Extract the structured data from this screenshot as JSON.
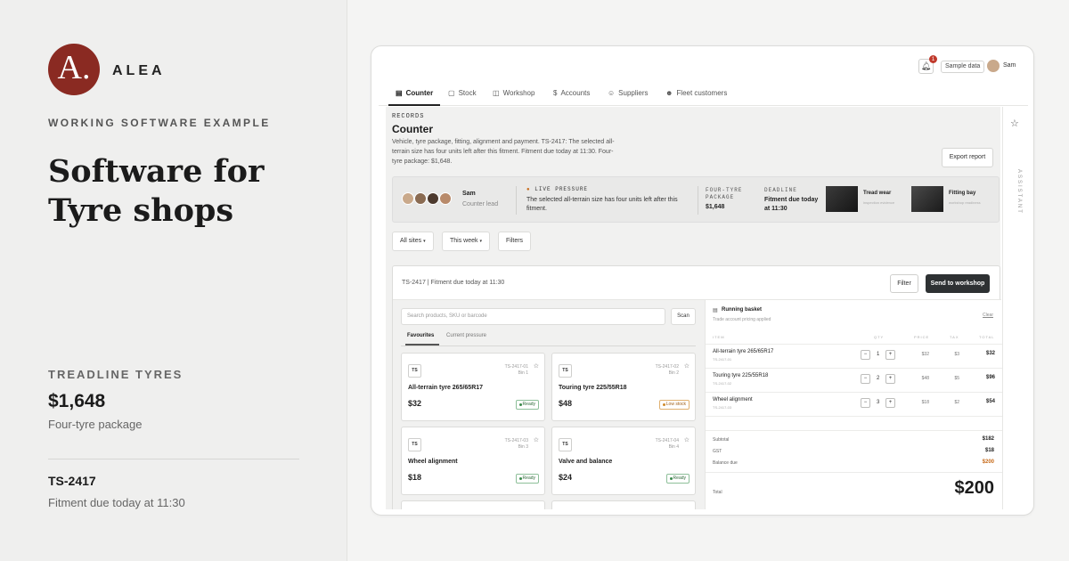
{
  "brand": {
    "logo_letter": "A.",
    "name": "ALEA",
    "eyebrow": "WORKING SOFTWARE EXAMPLE",
    "headline": "Software for Tyre shops",
    "accent": "#8a2a22"
  },
  "summary": {
    "company": "TREADLINE TYRES",
    "amount": "$1,648",
    "amount_label": "Four-tyre package",
    "job_id": "TS-2417",
    "job_status": "Fitment due today at 11:30"
  },
  "topbar": {
    "notification_count": "1",
    "sample_label": "Sample data",
    "user_name": "Sam"
  },
  "tabs": [
    {
      "label": "Counter",
      "icon": "store-icon"
    },
    {
      "label": "Stock",
      "icon": "box-icon"
    },
    {
      "label": "Workshop",
      "icon": "car-icon"
    },
    {
      "label": "Accounts",
      "icon": "dollar-icon"
    },
    {
      "label": "Suppliers",
      "icon": "users-icon"
    },
    {
      "label": "Fleet customers",
      "icon": "fleet-icon"
    }
  ],
  "page": {
    "section": "RECORDS",
    "title": "Counter",
    "description": "Vehicle, tyre package, fitting, alignment and payment. TS-2417: The selected all-terrain size has four units left after this fitment. Fitment due today at 11:30. Four-tyre package: $1,648.",
    "export_label": "Export report"
  },
  "pressure": {
    "person": "Sam",
    "role": "Counter lead",
    "live_label": "LIVE PRESSURE",
    "live_text": "The selected all-terrain size has four units left after this fitment.",
    "package_label": "FOUR-TYRE PACKAGE",
    "package_value": "$1,648",
    "deadline_label": "DEADLINE",
    "deadline_value": "Fitment due today at 11:30",
    "card1_title": "Tread wear",
    "card1_sub": "inspection evidence",
    "card2_title": "Fitting bay",
    "card2_sub": "workshop readiness"
  },
  "filters": {
    "sites": "All sites",
    "period": "This week",
    "filters": "Filters"
  },
  "panel": {
    "header": "TS-2417 | Fitment due today at 11:30",
    "filter_label": "Filter",
    "send_label": "Send to workshop"
  },
  "products": {
    "search_placeholder": "Search products, SKU or barcode",
    "scan_label": "Scan",
    "tab_favourites": "Favourites",
    "tab_pressure": "Current pressure",
    "items": [
      {
        "badge": "TS",
        "code": "TS-2417-01",
        "bin": "Bin 1",
        "name": "All-terrain tyre 265/65R17",
        "price": "$32",
        "status": "Ready"
      },
      {
        "badge": "TS",
        "code": "TS-2417-02",
        "bin": "Bin 2",
        "name": "Touring tyre 225/55R18",
        "price": "$48",
        "status": "Low stock"
      },
      {
        "badge": "TS",
        "code": "TS-2417-03",
        "bin": "Bin 3",
        "name": "Wheel alignment",
        "price": "$18",
        "status": "Ready"
      },
      {
        "badge": "TS",
        "code": "TS-2417-04",
        "bin": "Bin 4",
        "name": "Valve and balance",
        "price": "$24",
        "status": "Ready"
      }
    ]
  },
  "basket": {
    "title": "Running basket",
    "subtitle": "Trade account pricing applied",
    "clear": "Clear",
    "headers": {
      "item": "ITEM",
      "qty": "QTY",
      "price": "PRICE",
      "tax": "TAX",
      "total": "TOTAL"
    },
    "lines": [
      {
        "name": "All-terrain tyre 265/65R17",
        "code": "TS-2417-01",
        "qty": "1",
        "price": "$32",
        "tax": "$3",
        "total": "$32"
      },
      {
        "name": "Touring tyre 225/55R18",
        "code": "TS-2417-02",
        "qty": "2",
        "price": "$48",
        "tax": "$5",
        "total": "$96"
      },
      {
        "name": "Wheel alignment",
        "code": "TS-2417-03",
        "qty": "3",
        "price": "$18",
        "tax": "$2",
        "total": "$54"
      }
    ],
    "subtotal_label": "Subtotal",
    "subtotal": "$182",
    "gst_label": "GST",
    "gst": "$18",
    "due_label": "Balance due",
    "due": "$200",
    "total_label": "Total",
    "total": "$200"
  },
  "assistant_label": "ASSISTANT"
}
